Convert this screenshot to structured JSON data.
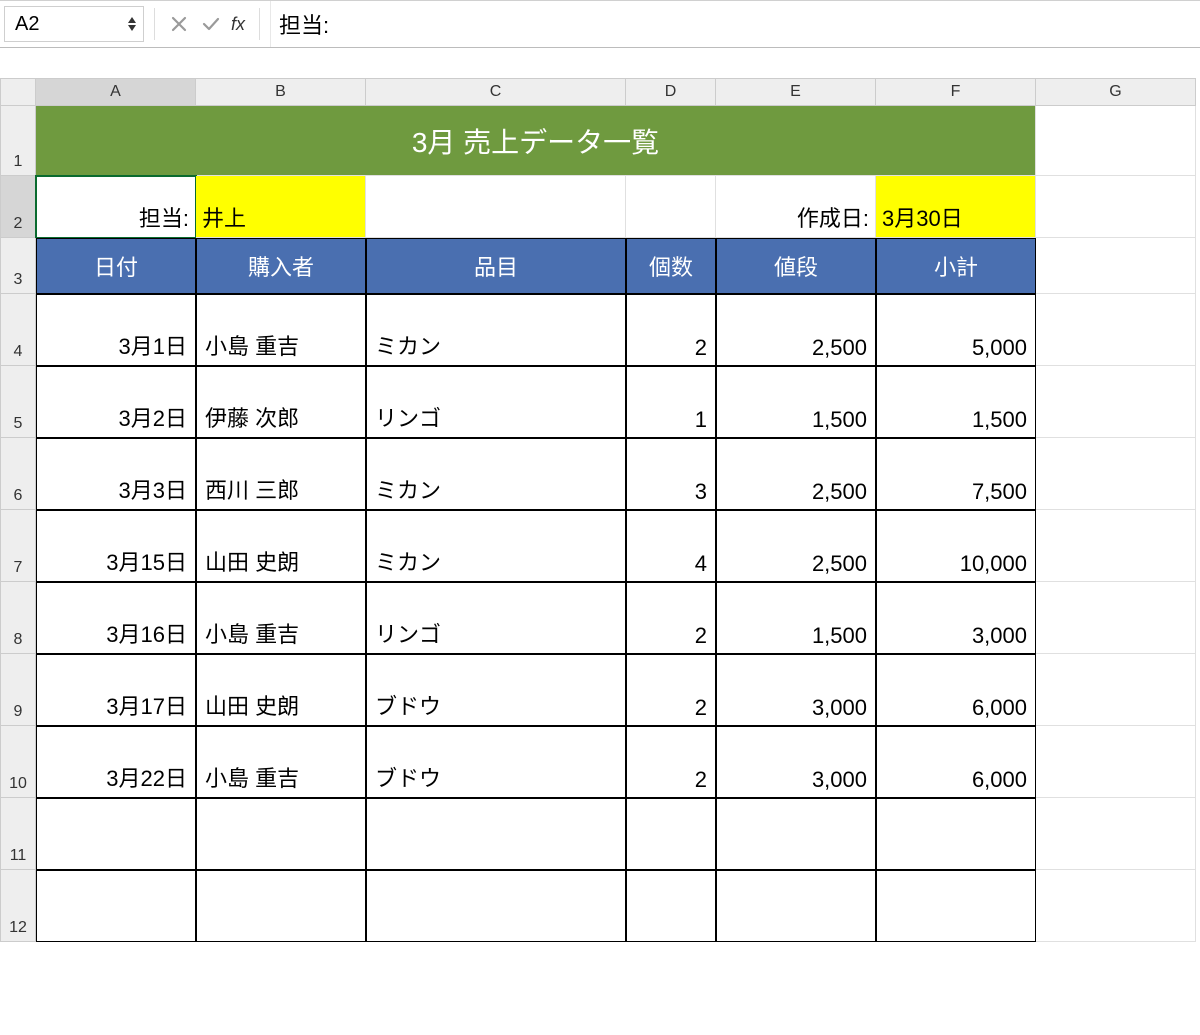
{
  "formula_bar": {
    "name_box": "A2",
    "fx_label": "fx",
    "content": "担当:"
  },
  "columns": [
    "A",
    "B",
    "C",
    "D",
    "E",
    "F",
    "G"
  ],
  "active_column_index": 0,
  "active_row": 2,
  "rows_visible": [
    1,
    2,
    3,
    4,
    5,
    6,
    7,
    8,
    9,
    10,
    11,
    12
  ],
  "title": "3月 売上データ一覧",
  "meta": {
    "staff_label": "担当:",
    "staff_value": "井上",
    "created_label": "作成日:",
    "created_value": "3月30日"
  },
  "table": {
    "headers": [
      "日付",
      "購入者",
      "品目",
      "個数",
      "値段",
      "小計"
    ],
    "rows": [
      {
        "date": "3月1日",
        "buyer": "小島 重吉",
        "item": "ミカン",
        "qty": "2",
        "price": "2,500",
        "subtotal": "5,000"
      },
      {
        "date": "3月2日",
        "buyer": "伊藤 次郎",
        "item": "リンゴ",
        "qty": "1",
        "price": "1,500",
        "subtotal": "1,500"
      },
      {
        "date": "3月3日",
        "buyer": "西川 三郎",
        "item": "ミカン",
        "qty": "3",
        "price": "2,500",
        "subtotal": "7,500"
      },
      {
        "date": "3月15日",
        "buyer": "山田 史朗",
        "item": "ミカン",
        "qty": "4",
        "price": "2,500",
        "subtotal": "10,000"
      },
      {
        "date": "3月16日",
        "buyer": "小島 重吉",
        "item": "リンゴ",
        "qty": "2",
        "price": "1,500",
        "subtotal": "3,000"
      },
      {
        "date": "3月17日",
        "buyer": "山田 史朗",
        "item": "ブドウ",
        "qty": "2",
        "price": "3,000",
        "subtotal": "6,000"
      },
      {
        "date": "3月22日",
        "buyer": "小島 重吉",
        "item": "ブドウ",
        "qty": "2",
        "price": "3,000",
        "subtotal": "6,000"
      }
    ],
    "empty_trailing_rows": 2
  }
}
